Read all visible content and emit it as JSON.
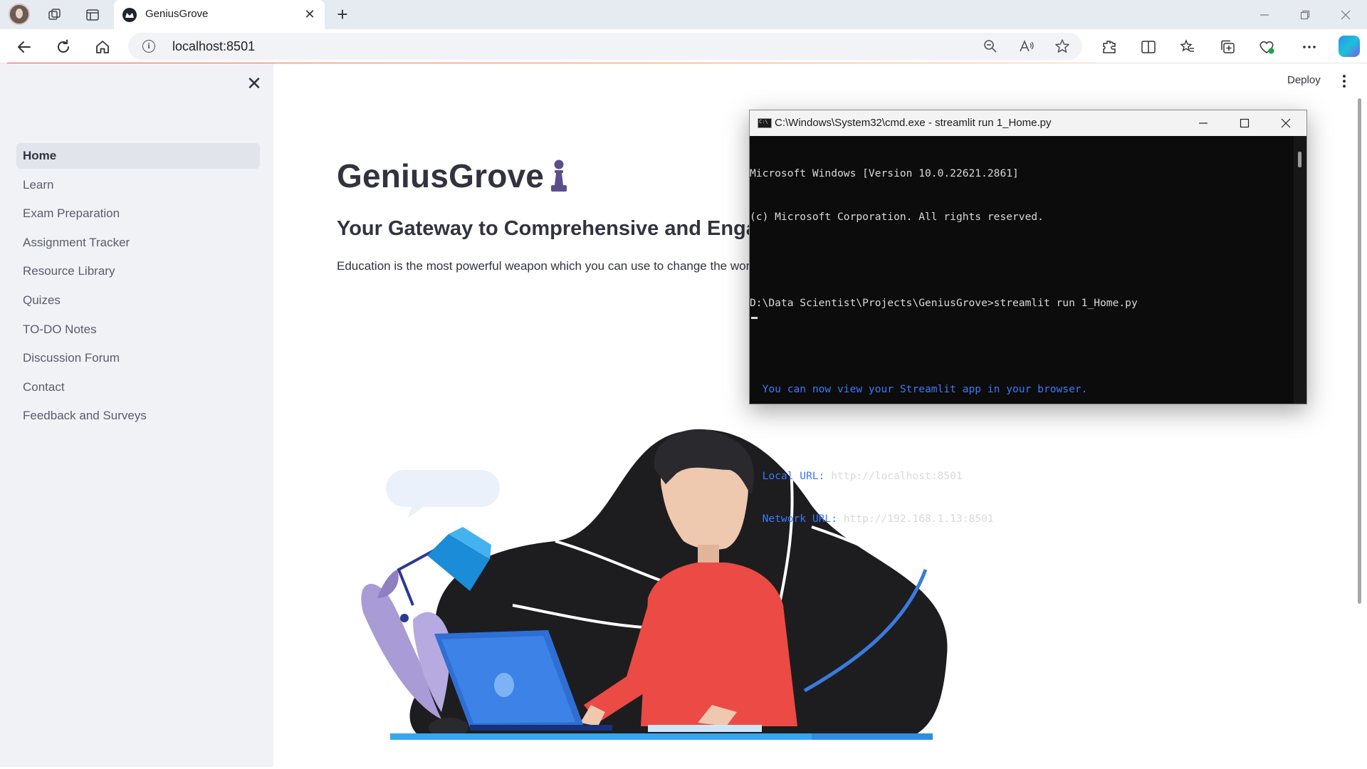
{
  "browser": {
    "tab_title": "GeniusGrove",
    "address": "localhost:8501"
  },
  "app": {
    "deploy_label": "Deploy",
    "title": "GeniusGrove",
    "subtitle": "Your Gateway to Comprehensive and Engag",
    "quote": "Education is the most powerful weapon which you can use to change the worl",
    "accent_color": "#ff4b4b",
    "sidebar_bg": "#f0f2f6"
  },
  "sidebar": {
    "items": [
      {
        "label": "Home",
        "active": true
      },
      {
        "label": "Learn"
      },
      {
        "label": "Exam Preparation"
      },
      {
        "label": "Assignment Tracker"
      },
      {
        "label": "Resource Library"
      },
      {
        "label": "Quizes"
      },
      {
        "label": "TO-DO Notes"
      },
      {
        "label": "Discussion Forum"
      },
      {
        "label": "Contact"
      },
      {
        "label": "Feedback and Surveys"
      }
    ]
  },
  "cmd": {
    "title": "C:\\Windows\\System32\\cmd.exe - streamlit  run 1_Home.py",
    "lines": {
      "l1": "Microsoft Windows [Version 10.0.22621.2861]",
      "l2": "(c) Microsoft Corporation. All rights reserved.",
      "l3": "D:\\Data Scientist\\Projects\\GeniusGrove>streamlit run 1_Home.py",
      "l4": "  You can now view your Streamlit app in your browser.",
      "local_label": "  Local URL: ",
      "local_url": "http://localhost:8501",
      "network_label": "  Network URL: ",
      "network_url": "http://192.168.1.13:8501"
    }
  }
}
